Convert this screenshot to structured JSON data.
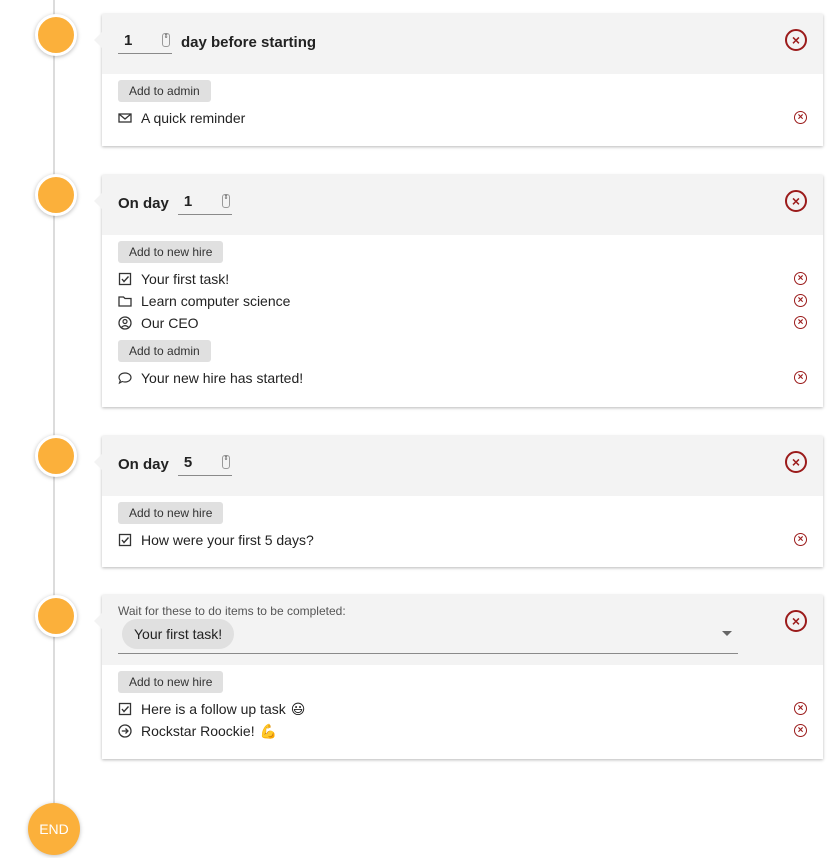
{
  "timeline": {
    "end_label": "END"
  },
  "steps": [
    {
      "prefix": "",
      "number": "1",
      "suffix": "day before starting",
      "groups": [
        {
          "button_label": "Add to admin",
          "items": [
            {
              "icon": "envelope-icon",
              "label": "A quick reminder"
            }
          ]
        }
      ]
    },
    {
      "prefix": "On day",
      "number": "1",
      "suffix": "",
      "groups": [
        {
          "button_label": "Add to new hire",
          "items": [
            {
              "icon": "checkbox-icon",
              "label": "Your first task!"
            },
            {
              "icon": "folder-icon",
              "label": "Learn computer science"
            },
            {
              "icon": "user-circle-icon",
              "label": "Our CEO"
            }
          ]
        },
        {
          "button_label": "Add to admin",
          "items": [
            {
              "icon": "chat-bubble-icon",
              "label": "Your new hire has started!"
            }
          ]
        }
      ]
    },
    {
      "prefix": "On day",
      "number": "5",
      "suffix": "",
      "groups": [
        {
          "button_label": "Add to new hire",
          "items": [
            {
              "icon": "checkbox-icon",
              "label": "How were your first 5 days?"
            }
          ]
        }
      ]
    },
    {
      "wait_label": "Wait for these to do items to be completed:",
      "selected_chip": "Your first task!",
      "groups": [
        {
          "button_label": "Add to new hire",
          "items": [
            {
              "icon": "checkbox-icon",
              "label": "Here is a follow up task",
              "emoji": "😃"
            },
            {
              "icon": "arrow-circle-icon",
              "label": "Rockstar Roockie!",
              "emoji": "💪"
            }
          ]
        }
      ]
    }
  ]
}
